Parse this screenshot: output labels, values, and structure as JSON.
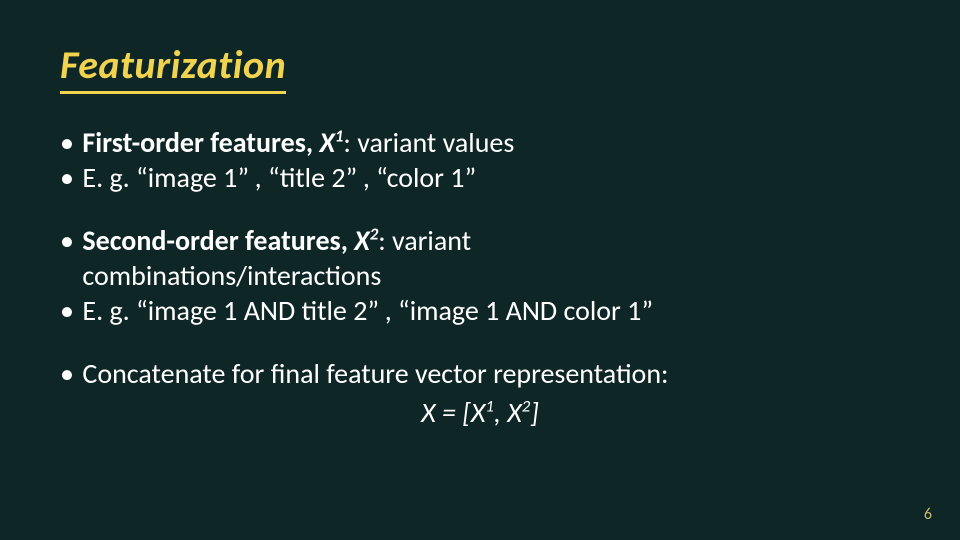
{
  "slide": {
    "title": "Featurization",
    "page_number": "6",
    "blocks": [
      {
        "b1_lead": "First-order features, ",
        "b1_var": "X",
        "b1_sup": "1",
        "b1_tail": ": variant values",
        "b2": "E. g. “image 1” , “title 2” , “color 1”"
      },
      {
        "b1_lead": "Second-order features, ",
        "b1_var": "X",
        "b1_sup": "2",
        "b1_tail": ": variant",
        "b1_cont": "combinations/interactions",
        "b2": "E. g. “image 1 AND title 2” , “image 1 AND color 1”"
      },
      {
        "b1": "Concatenate for final feature vector representation:",
        "formula_lhs_var": "X",
        "formula_eq": " = [",
        "formula_t1_var": "X",
        "formula_t1_sup": "1",
        "formula_sep": ", ",
        "formula_t2_var": "X",
        "formula_t2_sup": "2",
        "formula_close": "]"
      }
    ]
  }
}
